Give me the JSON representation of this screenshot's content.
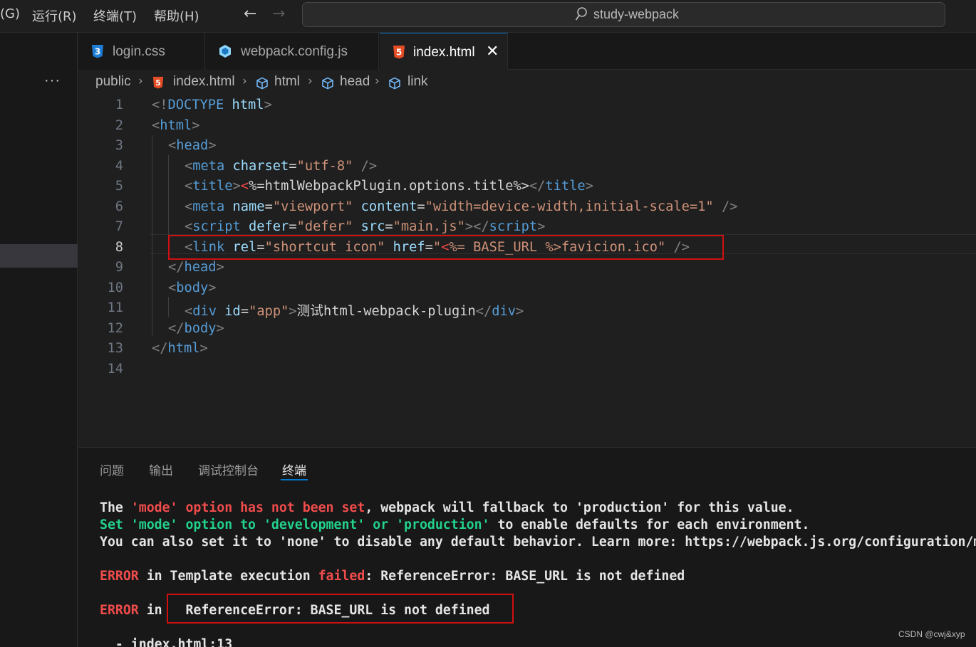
{
  "titlebar": {
    "menu": [
      "(G)",
      "运行(R)",
      "终端(T)",
      "帮助(H)"
    ],
    "back_arrow": "←",
    "forward_arrow": "→",
    "search_text": "study-webpack"
  },
  "sidebar": {
    "more": "···"
  },
  "tabs": [
    {
      "label": "login.css",
      "icon": "css-file-icon",
      "icon_text": "3",
      "active": false
    },
    {
      "label": "webpack.config.js",
      "icon": "webpack-file-icon",
      "active": false
    },
    {
      "label": "index.html",
      "icon": "html-file-icon",
      "icon_text": "5",
      "active": true,
      "close": "✕"
    }
  ],
  "breadcrumb": {
    "items": [
      "public",
      "index.html",
      "html",
      "head",
      "link"
    ],
    "separator": "›"
  },
  "editor": {
    "current_line": 8,
    "line_numbers": [
      "1",
      "2",
      "3",
      "4",
      "5",
      "6",
      "7",
      "8",
      "9",
      "10",
      "11",
      "12",
      "13",
      "14"
    ],
    "lines": [
      [
        [
          "p",
          "<!"
        ],
        [
          "tag",
          "DOCTYPE"
        ],
        [
          "txt",
          " "
        ],
        [
          "attr",
          "html"
        ],
        [
          "p",
          ">"
        ]
      ],
      [
        [
          "p",
          "<"
        ],
        [
          "tag",
          "html"
        ],
        [
          "p",
          ">"
        ]
      ],
      [
        [
          "p",
          "<"
        ],
        [
          "tag",
          "head"
        ],
        [
          "p",
          ">"
        ]
      ],
      [
        [
          "p",
          "<"
        ],
        [
          "tag",
          "meta"
        ],
        [
          "txt",
          " "
        ],
        [
          "attr",
          "charset"
        ],
        [
          "txt",
          "="
        ],
        [
          "str",
          "\"utf-8\""
        ],
        [
          "txt",
          " "
        ],
        [
          "p",
          "/>"
        ]
      ],
      [
        [
          "p",
          "<"
        ],
        [
          "tag",
          "title"
        ],
        [
          "p",
          ">"
        ],
        [
          "red",
          "<"
        ],
        [
          "txt",
          "%=htmlWebpackPlugin.options.title%>"
        ],
        [
          "p",
          "</"
        ],
        [
          "tag",
          "title"
        ],
        [
          "p",
          ">"
        ]
      ],
      [
        [
          "p",
          "<"
        ],
        [
          "tag",
          "meta"
        ],
        [
          "txt",
          " "
        ],
        [
          "attr",
          "name"
        ],
        [
          "txt",
          "="
        ],
        [
          "str",
          "\"viewport\""
        ],
        [
          "txt",
          " "
        ],
        [
          "attr",
          "content"
        ],
        [
          "txt",
          "="
        ],
        [
          "str",
          "\"width=device-width,initial-scale=1\""
        ],
        [
          "txt",
          " "
        ],
        [
          "p",
          "/>"
        ]
      ],
      [
        [
          "p",
          "<"
        ],
        [
          "tag",
          "script"
        ],
        [
          "txt",
          " "
        ],
        [
          "attr",
          "defer"
        ],
        [
          "txt",
          "="
        ],
        [
          "str",
          "\"defer\""
        ],
        [
          "txt",
          " "
        ],
        [
          "attr",
          "src"
        ],
        [
          "txt",
          "="
        ],
        [
          "str",
          "\"main.js\""
        ],
        [
          "p",
          "></"
        ],
        [
          "tag",
          "script"
        ],
        [
          "p",
          ">"
        ]
      ],
      [
        [
          "p",
          "<"
        ],
        [
          "tag",
          "link"
        ],
        [
          "txt",
          " "
        ],
        [
          "attr",
          "rel"
        ],
        [
          "txt",
          "="
        ],
        [
          "str",
          "\"shortcut icon\""
        ],
        [
          "txt",
          " "
        ],
        [
          "attr",
          "href"
        ],
        [
          "txt",
          "="
        ],
        [
          "str",
          "\""
        ],
        [
          "red",
          "<"
        ],
        [
          "str",
          "%= BASE_URL %>favicion.ico"
        ],
        [
          "str",
          "\""
        ],
        [
          "txt",
          " "
        ],
        [
          "p",
          "/>"
        ]
      ],
      [
        [
          "p",
          "</"
        ],
        [
          "tag",
          "head"
        ],
        [
          "p",
          ">"
        ]
      ],
      [
        [
          "p",
          "<"
        ],
        [
          "tag",
          "body"
        ],
        [
          "p",
          ">"
        ]
      ],
      [
        [
          "p",
          "<"
        ],
        [
          "tag",
          "div"
        ],
        [
          "txt",
          " "
        ],
        [
          "attr",
          "id"
        ],
        [
          "txt",
          "="
        ],
        [
          "str",
          "\"app\""
        ],
        [
          "p",
          ">"
        ],
        [
          "txt",
          "测试html-webpack-plugin"
        ],
        [
          "p",
          "</"
        ],
        [
          "tag",
          "div"
        ],
        [
          "p",
          ">"
        ]
      ],
      [
        [
          "p",
          "</"
        ],
        [
          "tag",
          "body"
        ],
        [
          "p",
          ">"
        ]
      ],
      [
        [
          "p",
          "</"
        ],
        [
          "tag",
          "html"
        ],
        [
          "p",
          ">"
        ]
      ],
      []
    ]
  },
  "panel": {
    "tabs": [
      "问题",
      "输出",
      "调试控制台",
      "终端"
    ],
    "active_tab": "终端",
    "terminal_lines": [
      [
        [
          "w",
          "The "
        ],
        [
          "r",
          "'mode' option has not been set"
        ],
        [
          "w",
          ", webpack will fallback to 'production' for this value."
        ]
      ],
      [
        [
          "g",
          "Set 'mode' option to 'development' or 'production'"
        ],
        [
          "w",
          " to enable defaults for each environment."
        ]
      ],
      [
        [
          "w",
          "You can also set it to 'none' to disable any default behavior. Learn more: https://webpack.js.org/configuration/mode/"
        ]
      ],
      [],
      [
        [
          "r",
          "ERROR"
        ],
        [
          "w",
          " in Template execution "
        ],
        [
          "r",
          "failed"
        ],
        [
          "w",
          ": ReferenceError: BASE_URL is not defined"
        ]
      ],
      [],
      [
        [
          "r",
          "ERROR"
        ],
        [
          "w",
          " in   ReferenceError: BASE_URL is not defined"
        ]
      ],
      [],
      [
        [
          "w",
          "  - index.html:13"
        ]
      ]
    ]
  },
  "watermark": "CSDN @cwj&xyp",
  "colors": {
    "background": "#1f1f1f",
    "accent": "#0078d4",
    "highlight_box": "#d01010",
    "error_red": "#f14c4c",
    "terminal_green": "#23d18b"
  }
}
